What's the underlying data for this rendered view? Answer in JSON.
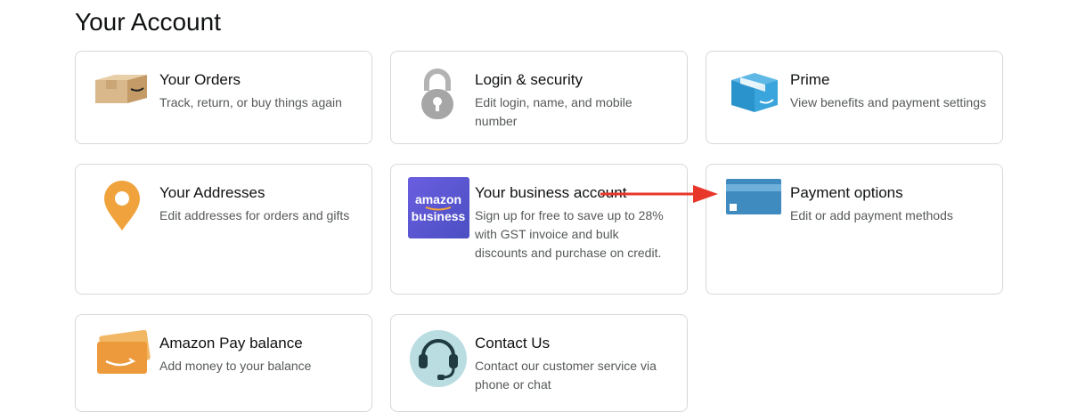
{
  "page": {
    "title": "Your Account"
  },
  "cards": [
    {
      "title": "Your Orders",
      "desc": "Track, return, or buy things again",
      "icon": "package-box-icon"
    },
    {
      "title": "Login & security",
      "desc": "Edit login, name, and mobile number",
      "icon": "lock-icon"
    },
    {
      "title": "Prime",
      "desc": "View benefits and payment settings",
      "icon": "prime-box-icon"
    },
    {
      "title": "Your Addresses",
      "desc": "Edit addresses for orders and gifts",
      "icon": "location-pin-icon"
    },
    {
      "title": "Your business account",
      "desc": "Sign up for free to save up to 28% with GST invoice and bulk discounts and purchase on credit.",
      "icon": "amazon-business-logo",
      "logo_line1": "amazon",
      "logo_line2": "business"
    },
    {
      "title": "Payment options",
      "desc": "Edit or add payment methods",
      "icon": "credit-card-icon"
    },
    {
      "title": "Amazon Pay balance",
      "desc": "Add money to your balance",
      "icon": "amazon-pay-card-icon"
    },
    {
      "title": "Contact Us",
      "desc": "Contact our customer service via phone or chat",
      "icon": "headset-icon"
    }
  ],
  "colors": {
    "accent_arrow": "#e8372a",
    "pin": "#f0a33c",
    "prime_blue": "#34a0d6",
    "card_blue": "#3f8bc0",
    "business_purple": "#5b5bd0",
    "pay_orange": "#ec9a3b",
    "headset_bg": "#b9dde1"
  }
}
